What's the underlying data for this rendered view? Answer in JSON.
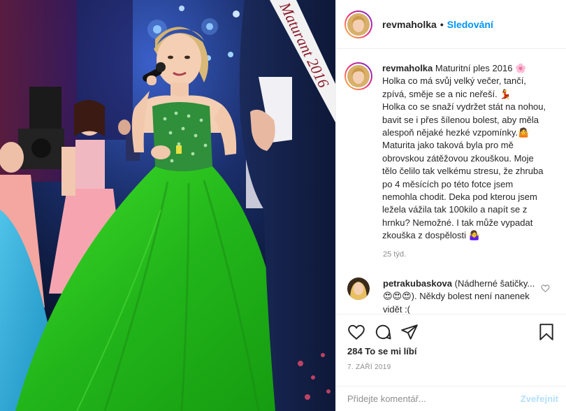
{
  "header": {
    "username": "revmaholka",
    "dot": "•",
    "follow_label": "Sledování"
  },
  "caption": {
    "username": "revmaholka",
    "text": " Maturitní ples 2016 🌸\nHolka co má svůj velký večer, tančí, zpívá, směje se a nic neřeší. 💃\nHolka co se snaží vydržet stát na nohou, bavit se i přes šílenou bolest, aby měla alespoň nějaké hezké vzpomínky.🤷 Maturita jako taková byla pro mě obrovskou zátěžovou zkouškou. Moje tělo čelilo tak velkému stresu, že zhruba po 4 měsících po této fotce jsem nemohla chodit. Deka pod kterou jsem ležela vážila tak 100kilo a napít se z hrnku? Nemožné. I tak může vypadat zkouška z dospělosti 🤷‍♀️",
    "time": "25 týd."
  },
  "comment": {
    "username": "petrakubaskova",
    "text": " (Nádherné šatičky... 😍😍😍). Někdy bolest není nanenek vidět :("
  },
  "photo": {
    "sash_text": "Maturant 2016"
  },
  "likes_label": "284 To se mi líbí",
  "date_label": "7. ZÁŘÍ 2019",
  "comment_input": {
    "placeholder": "Přidejte komentář...",
    "post_label": "Zveřejnit"
  },
  "icons": {
    "like": "heart-icon",
    "comment": "comment-icon",
    "share": "share-icon",
    "save": "bookmark-icon"
  }
}
